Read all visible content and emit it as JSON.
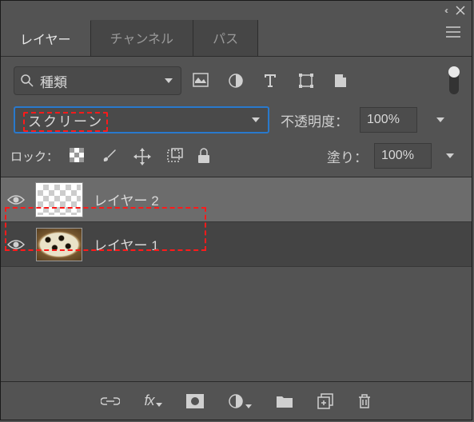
{
  "titlebar": {
    "collapse": "‹‹"
  },
  "tabs": {
    "layers": "レイヤー",
    "channels": "チャンネル",
    "paths": "パス"
  },
  "filter": {
    "kind": "種類"
  },
  "blend": {
    "mode": "スクリーン",
    "opacity_label": "不透明度：",
    "opacity_value": "100%"
  },
  "lock": {
    "label": "ロック：",
    "fill_label": "塗り：",
    "fill_value": "100%"
  },
  "layers": [
    {
      "name": "レイヤー 2",
      "selected": true,
      "thumb": "trans"
    },
    {
      "name": "レイヤー 1",
      "selected": false,
      "thumb": "food"
    }
  ],
  "footer": {
    "fx": "fx"
  }
}
